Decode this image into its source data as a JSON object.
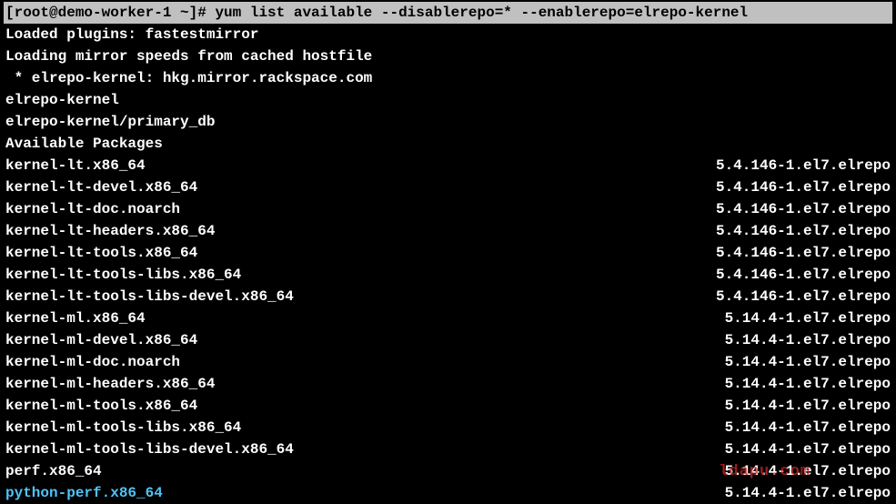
{
  "prompt": {
    "text": "[root@demo-worker-1 ~]# yum list available --disablerepo=* --enablerepo=elrepo-kernel"
  },
  "messages": [
    "Loaded plugins: fastestmirror",
    "Loading mirror speeds from cached hostfile",
    " * elrepo-kernel: hkg.mirror.rackspace.com",
    "elrepo-kernel",
    "elrepo-kernel/primary_db",
    "Available Packages"
  ],
  "packages": [
    {
      "name": "kernel-lt.x86_64",
      "version": "5.4.146-1.el7.elrepo"
    },
    {
      "name": "kernel-lt-devel.x86_64",
      "version": "5.4.146-1.el7.elrepo"
    },
    {
      "name": "kernel-lt-doc.noarch",
      "version": "5.4.146-1.el7.elrepo"
    },
    {
      "name": "kernel-lt-headers.x86_64",
      "version": "5.4.146-1.el7.elrepo"
    },
    {
      "name": "kernel-lt-tools.x86_64",
      "version": "5.4.146-1.el7.elrepo"
    },
    {
      "name": "kernel-lt-tools-libs.x86_64",
      "version": "5.4.146-1.el7.elrepo"
    },
    {
      "name": "kernel-lt-tools-libs-devel.x86_64",
      "version": "5.4.146-1.el7.elrepo"
    },
    {
      "name": "kernel-ml.x86_64",
      "version": "5.14.4-1.el7.elrepo"
    },
    {
      "name": "kernel-ml-devel.x86_64",
      "version": "5.14.4-1.el7.elrepo"
    },
    {
      "name": "kernel-ml-doc.noarch",
      "version": "5.14.4-1.el7.elrepo"
    },
    {
      "name": "kernel-ml-headers.x86_64",
      "version": "5.14.4-1.el7.elrepo"
    },
    {
      "name": "kernel-ml-tools.x86_64",
      "version": "5.14.4-1.el7.elrepo"
    },
    {
      "name": "kernel-ml-tools-libs.x86_64",
      "version": "5.14.4-1.el7.elrepo"
    },
    {
      "name": "kernel-ml-tools-libs-devel.x86_64",
      "version": "5.14.4-1.el7.elrepo"
    },
    {
      "name": "perf.x86_64",
      "version": "5.14.4-1.el7.elrepo"
    },
    {
      "name": "python-perf.x86_64",
      "version": "5.14.4-1.el7.elrepo",
      "highlight": true
    }
  ],
  "watermark": "ldapu.com"
}
